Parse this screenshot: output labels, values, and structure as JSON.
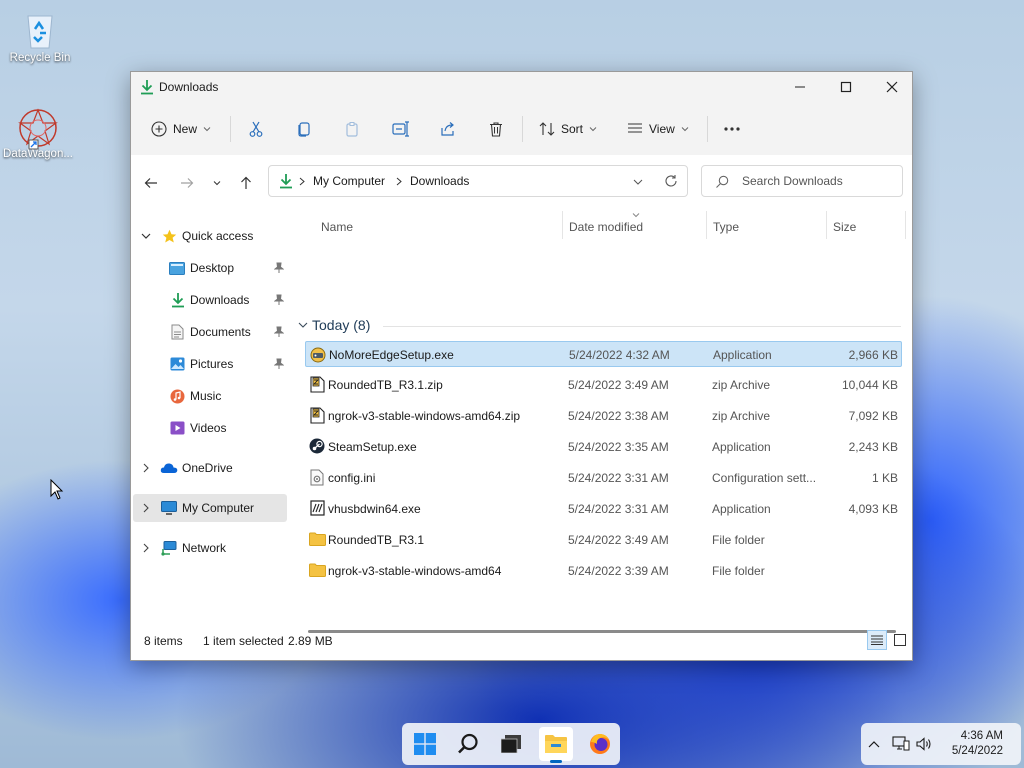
{
  "desktop": {
    "icons": [
      {
        "label": "Recycle Bin",
        "icon": "recycle-bin-icon"
      },
      {
        "label": "DataWagon...",
        "icon": "datawagon-app-icon"
      }
    ]
  },
  "window": {
    "title": "Downloads",
    "controls": {
      "minimize": "minimize-icon",
      "maximize": "maximize-icon",
      "close": "close-icon"
    }
  },
  "toolbar": {
    "new_label": "New",
    "sort_label": "Sort",
    "view_label": "View",
    "icons": [
      "cut-icon",
      "copy-icon",
      "paste-icon",
      "rename-icon",
      "share-icon",
      "delete-icon"
    ]
  },
  "navigation": {
    "breadcrumb": [
      "My Computer",
      "Downloads"
    ],
    "search_placeholder": "Search Downloads"
  },
  "sidebar": {
    "quick_access": "Quick access",
    "items": [
      {
        "label": "Desktop",
        "icon": "desktop-folder-icon",
        "pinned": true
      },
      {
        "label": "Downloads",
        "icon": "downloads-folder-icon",
        "pinned": true
      },
      {
        "label": "Documents",
        "icon": "documents-folder-icon",
        "pinned": true
      },
      {
        "label": "Pictures",
        "icon": "pictures-folder-icon",
        "pinned": true
      },
      {
        "label": "Music",
        "icon": "music-folder-icon",
        "pinned": false
      },
      {
        "label": "Videos",
        "icon": "videos-folder-icon",
        "pinned": false
      }
    ],
    "onedrive": "OneDrive",
    "my_computer": "My Computer",
    "network": "Network"
  },
  "file_list": {
    "columns": [
      "Name",
      "Date modified",
      "Type",
      "Size"
    ],
    "group_label": "Today (8)",
    "rows": [
      {
        "name": "NoMoreEdgeSetup.exe",
        "date": "5/24/2022 4:32 AM",
        "type": "Application",
        "size": "2,966 KB",
        "icon": "setup-exe-icon",
        "selected": true
      },
      {
        "name": "RoundedTB_R3.1.zip",
        "date": "5/24/2022 3:49 AM",
        "type": "zip Archive",
        "size": "10,044 KB",
        "icon": "zip-archive-icon",
        "selected": false
      },
      {
        "name": "ngrok-v3-stable-windows-amd64.zip",
        "date": "5/24/2022 3:38 AM",
        "type": "zip Archive",
        "size": "7,092 KB",
        "icon": "zip-archive-icon",
        "selected": false
      },
      {
        "name": "SteamSetup.exe",
        "date": "5/24/2022 3:35 AM",
        "type": "Application",
        "size": "2,243 KB",
        "icon": "steam-icon",
        "selected": false
      },
      {
        "name": "config.ini",
        "date": "5/24/2022 3:31 AM",
        "type": "Configuration sett...",
        "size": "1 KB",
        "icon": "config-file-icon",
        "selected": false
      },
      {
        "name": "vhusbdwin64.exe",
        "date": "5/24/2022 3:31 AM",
        "type": "Application",
        "size": "4,093 KB",
        "icon": "exe-icon",
        "selected": false
      },
      {
        "name": "RoundedTB_R3.1",
        "date": "5/24/2022 3:49 AM",
        "type": "File folder",
        "size": "",
        "icon": "folder-icon",
        "selected": false
      },
      {
        "name": "ngrok-v3-stable-windows-amd64",
        "date": "5/24/2022 3:39 AM",
        "type": "File folder",
        "size": "",
        "icon": "folder-icon",
        "selected": false
      }
    ]
  },
  "status_bar": {
    "item_count": "8 items",
    "selection": "1 item selected",
    "selection_size": "2.89 MB"
  },
  "taskbar": {
    "apps": [
      "start-icon",
      "search-icon",
      "terminal-icon",
      "file-explorer-icon",
      "firefox-icon"
    ]
  },
  "tray": {
    "time": "4:36 AM",
    "date": "5/24/2022"
  },
  "colors": {
    "accent": "#0067c0",
    "selection": "#cce4f7",
    "download_green": "#1f9d55",
    "folder_yellow": "#f4c242"
  }
}
